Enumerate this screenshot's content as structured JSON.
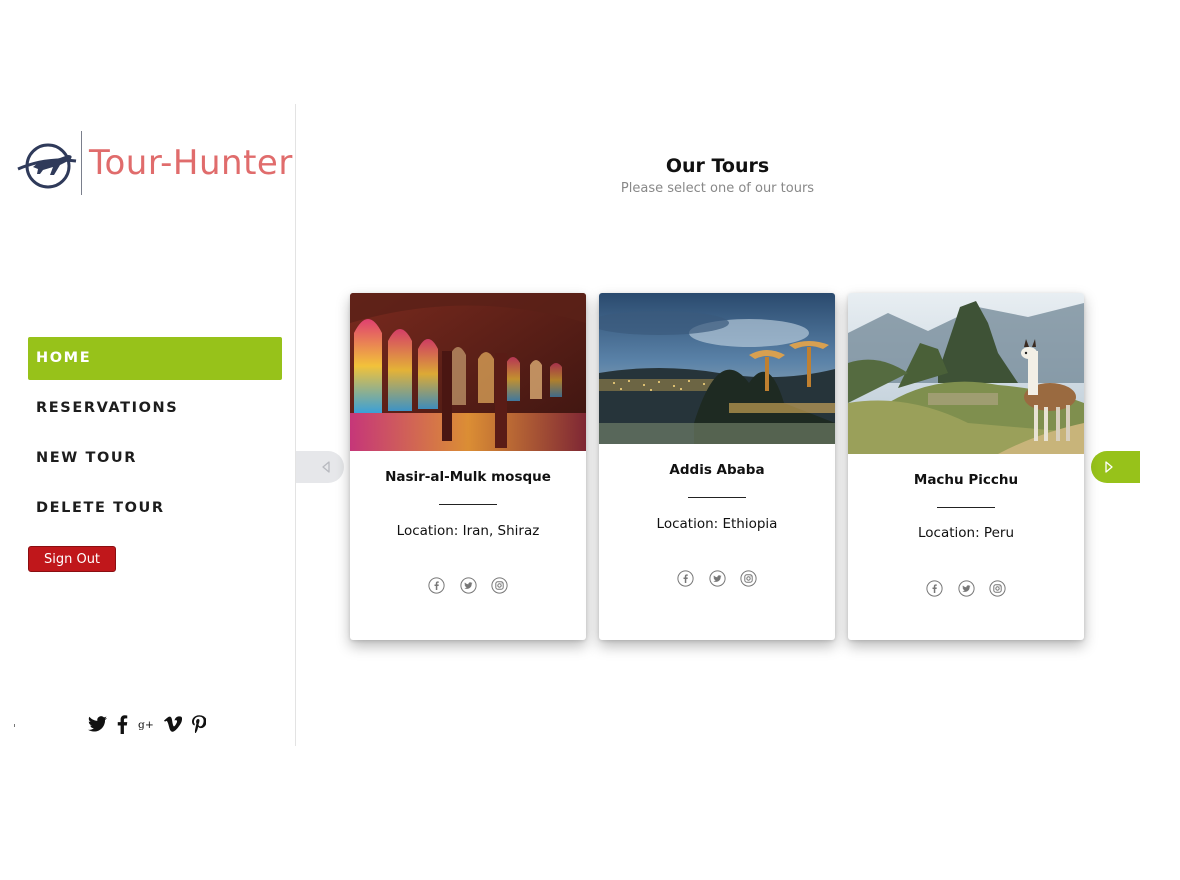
{
  "brand": {
    "name": "Tour-Hunter",
    "color": "#e06c6c",
    "mark_color": "#2f3a5a"
  },
  "nav": {
    "items": [
      {
        "label": "HOME",
        "active": true
      },
      {
        "label": "RESERVATIONS",
        "active": false
      },
      {
        "label": "NEW TOUR",
        "active": false
      },
      {
        "label": "DELETE TOUR",
        "active": false
      }
    ],
    "active_color": "#97c21a"
  },
  "signout": {
    "label": "Sign Out",
    "color": "#c0171b"
  },
  "social_icons": [
    "twitter-icon",
    "facebook-icon",
    "google-plus-icon",
    "vimeo-icon",
    "pinterest-icon"
  ],
  "main": {
    "title": "Our Tours",
    "subtitle": "Please select one of our tours"
  },
  "tours": [
    {
      "title": "Nasir-al-Mulk mosque",
      "location": "Location: Iran, Shiraz",
      "image": "mosque-interior-stained-glass"
    },
    {
      "title": "Addis Ababa",
      "location": "Location: Ethiopia",
      "image": "city-night-view"
    },
    {
      "title": "Machu Picchu",
      "location": "Location: Peru",
      "image": "mountain-ruins-llama"
    }
  ],
  "card_icons": [
    "facebook-icon",
    "twitter-icon",
    "instagram-icon"
  ],
  "carousel": {
    "prev_icon": "chevron-left-icon",
    "next_icon": "chevron-right-icon",
    "next_color": "#97c21a"
  }
}
